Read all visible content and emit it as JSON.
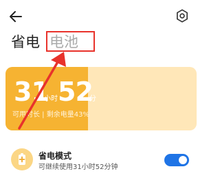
{
  "header": {
    "back_icon": "back-arrow-icon",
    "settings_icon": "gear-icon",
    "tab_power_saving": "省电",
    "tab_battery": "电池"
  },
  "battery_card": {
    "hours": "31",
    "hours_unit": "小时",
    "minutes": "52",
    "minutes_unit": "分",
    "remaining_label": "可用时长 | 剩余电量43%",
    "charge_level": 0.43,
    "fill_color": "#f6b332",
    "track_color": "#ffe7b8"
  },
  "power_saving_mode": {
    "title": "省电模式",
    "subtitle": "可继续使用31小时52分钟",
    "enabled": true,
    "toggle_color": "#1f74e6"
  },
  "annotation": {
    "color": "#e8322b"
  }
}
